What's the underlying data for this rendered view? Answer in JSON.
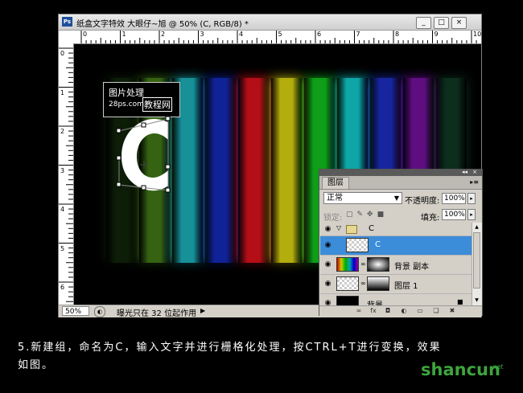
{
  "window": {
    "title": "纸盒文字特效 大眼仔~旭 @ 50% (C, RGB/8) *",
    "app_icon": "Ps",
    "minimize": "_",
    "maximize": "□",
    "close": "×"
  },
  "ruler": {
    "h_numbers": [
      "0",
      "1",
      "2",
      "3",
      "4",
      "5",
      "6",
      "7",
      "8",
      "9",
      "10"
    ],
    "v_numbers": [
      "0",
      "1",
      "2",
      "3",
      "4",
      "5",
      "6",
      "7"
    ]
  },
  "canvas": {
    "bar_colors": [
      "#1a3a10",
      "#3b6e14",
      "#1aa0a8",
      "#1226a8",
      "#c8101a",
      "#c8c010",
      "#10b01a",
      "#10b8b8",
      "#1a2ab0",
      "#6a1090",
      "#1a5a3a"
    ],
    "logo_line1": "图片处理",
    "logo_line2": "28ps.com",
    "logo_line3": "教程网"
  },
  "status": {
    "zoom": "50%",
    "message": "曝光只在 32 位起作用"
  },
  "layers_panel": {
    "tab": "图层",
    "blend_mode": "正常",
    "opacity_label": "不透明度:",
    "opacity_value": "100%",
    "lock_label": "锁定:",
    "fill_label": "填充:",
    "fill_value": "100%",
    "layers": [
      {
        "name": "C",
        "type": "group"
      },
      {
        "name": "C",
        "type": "text-raster",
        "selected": true
      },
      {
        "name": "背景 副本",
        "type": "masked"
      },
      {
        "name": "图层 1",
        "type": "masked"
      },
      {
        "name": "背景",
        "type": "background"
      }
    ]
  },
  "caption": {
    "line1": "5.新建组，命名为C，输入文字并进行栅格化处理，按CTRL+T进行变换，效果",
    "line2": "如图。"
  },
  "watermark": {
    "text": "shancun",
    "sub": ".net"
  }
}
